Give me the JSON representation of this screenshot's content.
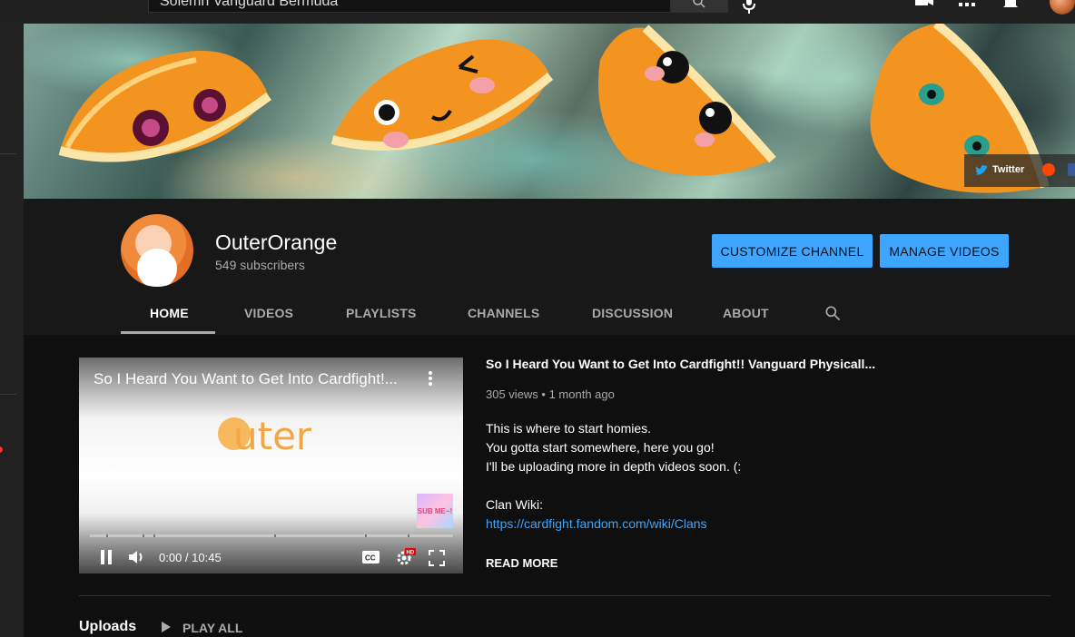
{
  "masthead": {
    "search_value": "Solemn Vanguard Bermuda"
  },
  "banner": {
    "social_links": [
      {
        "label": "Twitter"
      }
    ]
  },
  "channel": {
    "name": "OuterOrange",
    "subscribers": "549 subscribers",
    "customize_label": "CUSTOMIZE CHANNEL",
    "manage_label": "MANAGE VIDEOS"
  },
  "tabs": [
    {
      "label": "HOME",
      "active": true
    },
    {
      "label": "VIDEOS"
    },
    {
      "label": "PLAYLISTS"
    },
    {
      "label": "CHANNELS"
    },
    {
      "label": "DISCUSSION"
    },
    {
      "label": "ABOUT"
    }
  ],
  "featured": {
    "player_title": "So I Heard You Want to Get Into Cardfight!...",
    "logo_text": "uter",
    "sub_badge": "SUB ME~!",
    "time": "0:00 / 10:45",
    "title": "So I Heard You Want to Get Into Cardfight!! Vanguard Physicall...",
    "meta": "305 views • 1 month ago",
    "description": [
      "This is where to start homies.",
      "You gotta start somewhere, here you go!",
      "I'll be uploading more in depth videos soon. (:",
      "",
      "Clan Wiki:"
    ],
    "link": "https://cardfight.fandom.com/wiki/Clans",
    "read_more": "READ MORE"
  },
  "uploads": {
    "title": "Uploads",
    "play_all": "PLAY ALL"
  },
  "colors": {
    "accent_blue": "#3ea6ff",
    "background": "#0f0f0f",
    "header_bg": "#181818"
  }
}
